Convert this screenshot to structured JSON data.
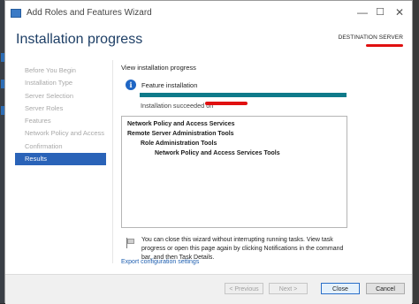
{
  "window": {
    "title": "Add Roles and Features Wizard"
  },
  "header": {
    "title": "Installation progress",
    "destination_label": "DESTINATION SERVER"
  },
  "sidebar": {
    "items": [
      {
        "label": "Before You Begin",
        "active": false
      },
      {
        "label": "Installation Type",
        "active": false
      },
      {
        "label": "Server Selection",
        "active": false
      },
      {
        "label": "Server Roles",
        "active": false
      },
      {
        "label": "Features",
        "active": false
      },
      {
        "label": "Network Policy and Access ...",
        "active": false
      },
      {
        "label": "Confirmation",
        "active": false
      },
      {
        "label": "Results",
        "active": true
      }
    ]
  },
  "main": {
    "section_label": "View installation progress",
    "status_title": "Feature installation",
    "progress": 1.0,
    "succeeded_text": "Installation succeeded on",
    "results": [
      {
        "text": "Network Policy and Access Services",
        "level": 0
      },
      {
        "text": "Remote Server Administration Tools",
        "level": 0
      },
      {
        "text": "Role Administration Tools",
        "level": 1
      },
      {
        "text": "Network Policy and Access Services Tools",
        "level": 2
      }
    ],
    "close_note": "You can close this wizard without interrupting running tasks. View task progress or open this page again by clicking Notifications in the command bar, and then Task Details.",
    "export_link": "Export configuration settings"
  },
  "footer": {
    "previous_label": "< Previous",
    "next_label": "Next >",
    "close_label": "Close",
    "cancel_label": "Cancel"
  },
  "colors": {
    "accent": "#2a63b8",
    "progress": "#0f7a8a",
    "redaction": "#e01010",
    "title": "#1e3f66"
  }
}
